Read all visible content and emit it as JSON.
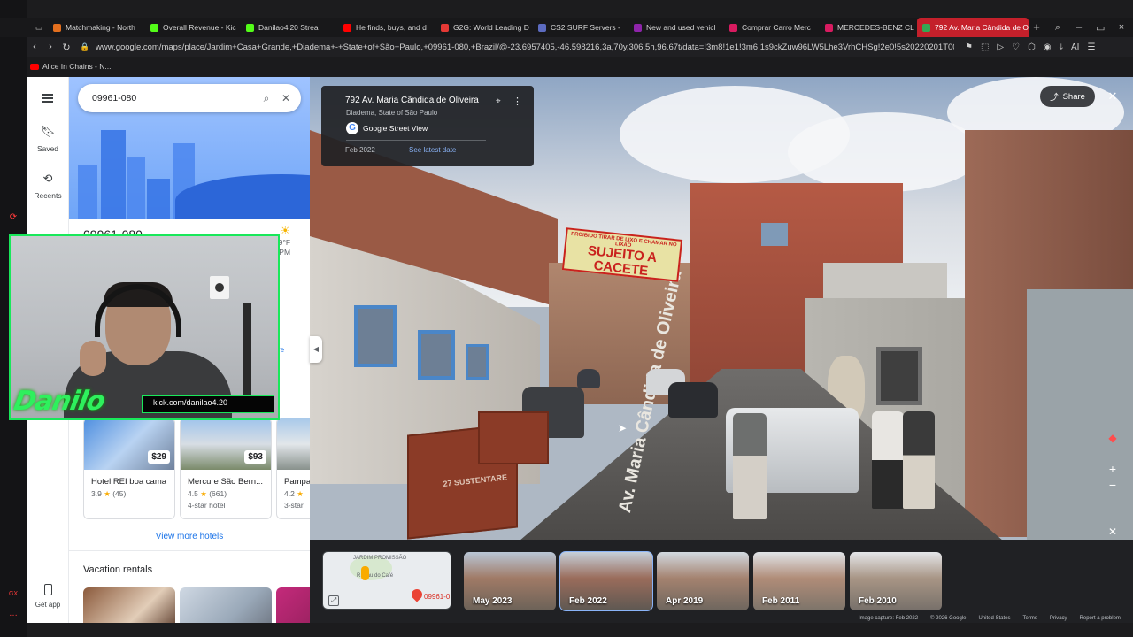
{
  "browser": {
    "tabs": [
      {
        "label": "Matchmaking - North",
        "color": "#e36f1e"
      },
      {
        "label": "Overall Revenue - Kic",
        "color": "#53fc18"
      },
      {
        "label": "Danilao4i20 Strea",
        "color": "#53fc18"
      },
      {
        "label": "He finds, buys, and d",
        "color": "#ff0000"
      },
      {
        "label": "G2G: World Leading D",
        "color": "#e53935"
      },
      {
        "label": "CS2 SURF Servers -",
        "color": "#5c6bc0"
      },
      {
        "label": "New and used vehicl",
        "color": "#8e24aa"
      },
      {
        "label": "Comprar Carro Merc",
        "color": "#d81b60"
      },
      {
        "label": "MERCEDES-BENZ CL",
        "color": "#d81b60"
      },
      {
        "label": "792 Av. Maria Cândida de O",
        "color": "#34a853"
      }
    ],
    "url": "www.google.com/maps/place/Jardim+Casa+Grande,+Diadema+-+State+of+São+Paulo,+09961-080,+Brazil/@-23.6957405,-46.598216,3a,70y,306.5h,96.67t/data=!3m8!1e1!3m6!1s9ckZuw96LW5Lhe3VrhCHSg!2e0!5s20220201T0000",
    "ai_label": "AI",
    "bookmark": "Alice In Chains - N..."
  },
  "maps": {
    "rail": {
      "saved": "Saved",
      "recents": "Recents",
      "get_app": "Get app"
    },
    "search": {
      "value": "09961-080"
    },
    "place_title": "09961-080",
    "weather": {
      "temp": "79°F",
      "time": "PM"
    },
    "side_stub": "re",
    "hotels": [
      {
        "name": "Hotel REI boa cama",
        "rating": "3.9",
        "reviews": "(45)",
        "price": "$29",
        "extra": ""
      },
      {
        "name": "Mercure São Bern...",
        "rating": "4.5",
        "reviews": "(661)",
        "price": "$93",
        "extra": "4-star hotel"
      },
      {
        "name": "Pampa",
        "rating": "4.2",
        "reviews": "",
        "price": "",
        "extra": "3-star"
      }
    ],
    "view_more": "View more hotels",
    "vacation_title": "Vacation rentals"
  },
  "stream_overlay": {
    "logo": "Danilo",
    "handle": "kick.com/danilao4.20"
  },
  "street_view": {
    "address": "792 Av. Maria Cândida de Oliveira",
    "locality": "Diadema, State of São Paulo",
    "source": "Google Street View",
    "capture_date": "Feb 2022",
    "latest_link": "See latest date",
    "share": "Share",
    "banner_top": "PROIBIDO TIRAR DE LIXO E CHAMAR NO LIXAO",
    "banner_main": "SUJEITO A CACETE",
    "road_text": "Av. Maria Cândida de Oliveira",
    "dumpster_text": "27 SUSTENTARE"
  },
  "minimap": {
    "labels": [
      "JARDIM PROMISSÃO",
      "R. Pau do Café"
    ],
    "pin_label": "09961-0"
  },
  "timeline": [
    {
      "label": "May 2023",
      "selected": false
    },
    {
      "label": "Feb 2022",
      "selected": true
    },
    {
      "label": "Apr 2019",
      "selected": false
    },
    {
      "label": "Feb 2011",
      "selected": false
    },
    {
      "label": "Feb 2010",
      "selected": false
    }
  ],
  "attribution": {
    "capture": "Image capture: Feb 2022",
    "copyright": "© 2026 Google",
    "region": "United States",
    "terms": "Terms",
    "privacy": "Privacy",
    "report": "Report a problem"
  },
  "colors": {
    "accent": "#1a73e8",
    "stream_green": "#19e85a",
    "opera_red": "#c4202b"
  }
}
